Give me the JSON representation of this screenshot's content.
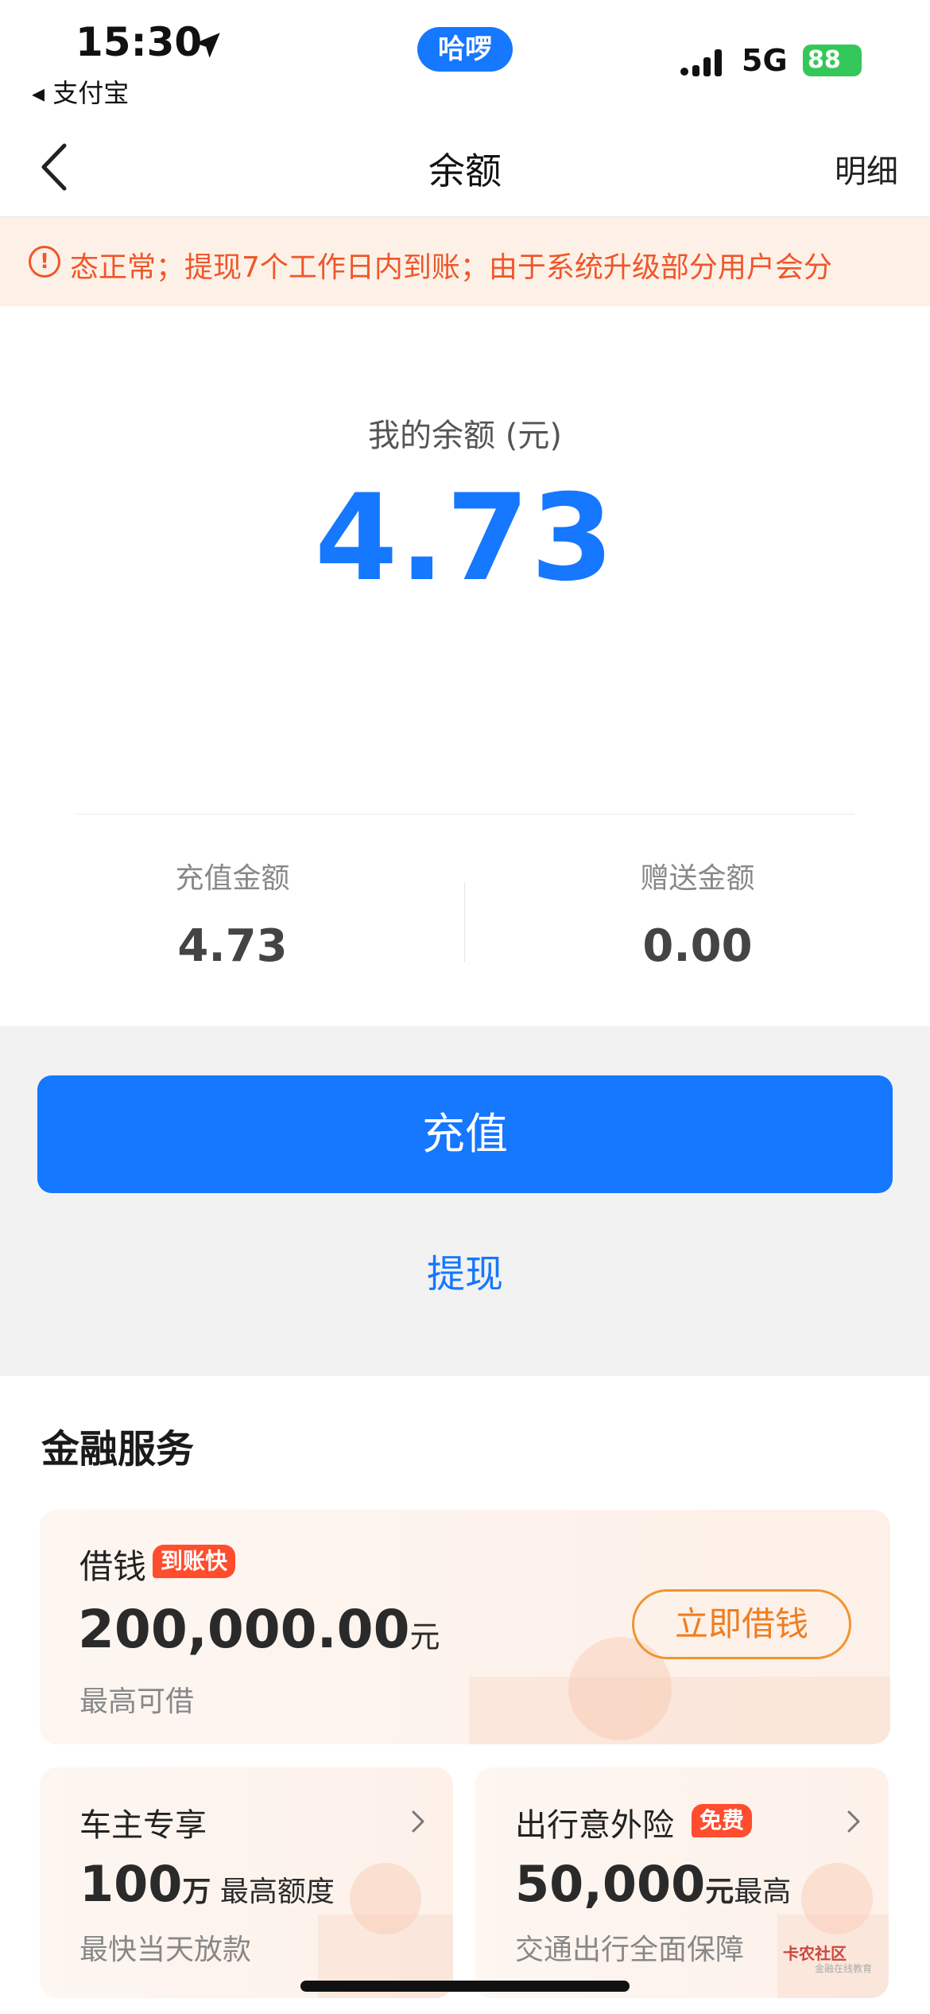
{
  "status_bar": {
    "time": "15:30",
    "back_app": "◂ 支付宝",
    "pill": "哈啰",
    "network": "5G",
    "battery": "88"
  },
  "nav": {
    "title": "余额",
    "detail": "明细"
  },
  "notice": {
    "text": "态正常；提现7个工作日内到账；由于系统升级部分用户会分"
  },
  "balance": {
    "label": "我的余额 (元)",
    "value": "4.73",
    "recharge_label": "充值金额",
    "recharge_value": "4.73",
    "gift_label": "赠送金额",
    "gift_value": "0.00"
  },
  "actions": {
    "recharge_button": "充值",
    "withdraw_link": "提现"
  },
  "finance": {
    "title": "金融服务",
    "loan": {
      "name": "借钱",
      "badge": "到账快",
      "amount": "200,000.00",
      "unit": "元",
      "sub": "最高可借",
      "button": "立即借钱"
    },
    "car": {
      "title": "车主专享",
      "main": "100",
      "unit": "万",
      "tail": " 最高额度",
      "sub": "最快当天放款"
    },
    "insurance": {
      "title": "出行意外险",
      "badge": "免费",
      "main": "50,000",
      "unit": "元",
      "tail": "最高",
      "sub": "交通出行全面保障"
    }
  },
  "watermark": {
    "text": "卡农社区",
    "sub": "金融在线教育"
  },
  "colors": {
    "accent": "#1677ff",
    "notice_text": "#f0562a",
    "notice_bg": "#fdf1e7",
    "badge": "#ff4d2d",
    "loan_button": "#f07d1e"
  },
  "icons": [
    "location-arrow-icon",
    "signal-icon",
    "battery-icon",
    "back-chevron-icon",
    "alert-circle-icon",
    "chevron-right-icon"
  ]
}
